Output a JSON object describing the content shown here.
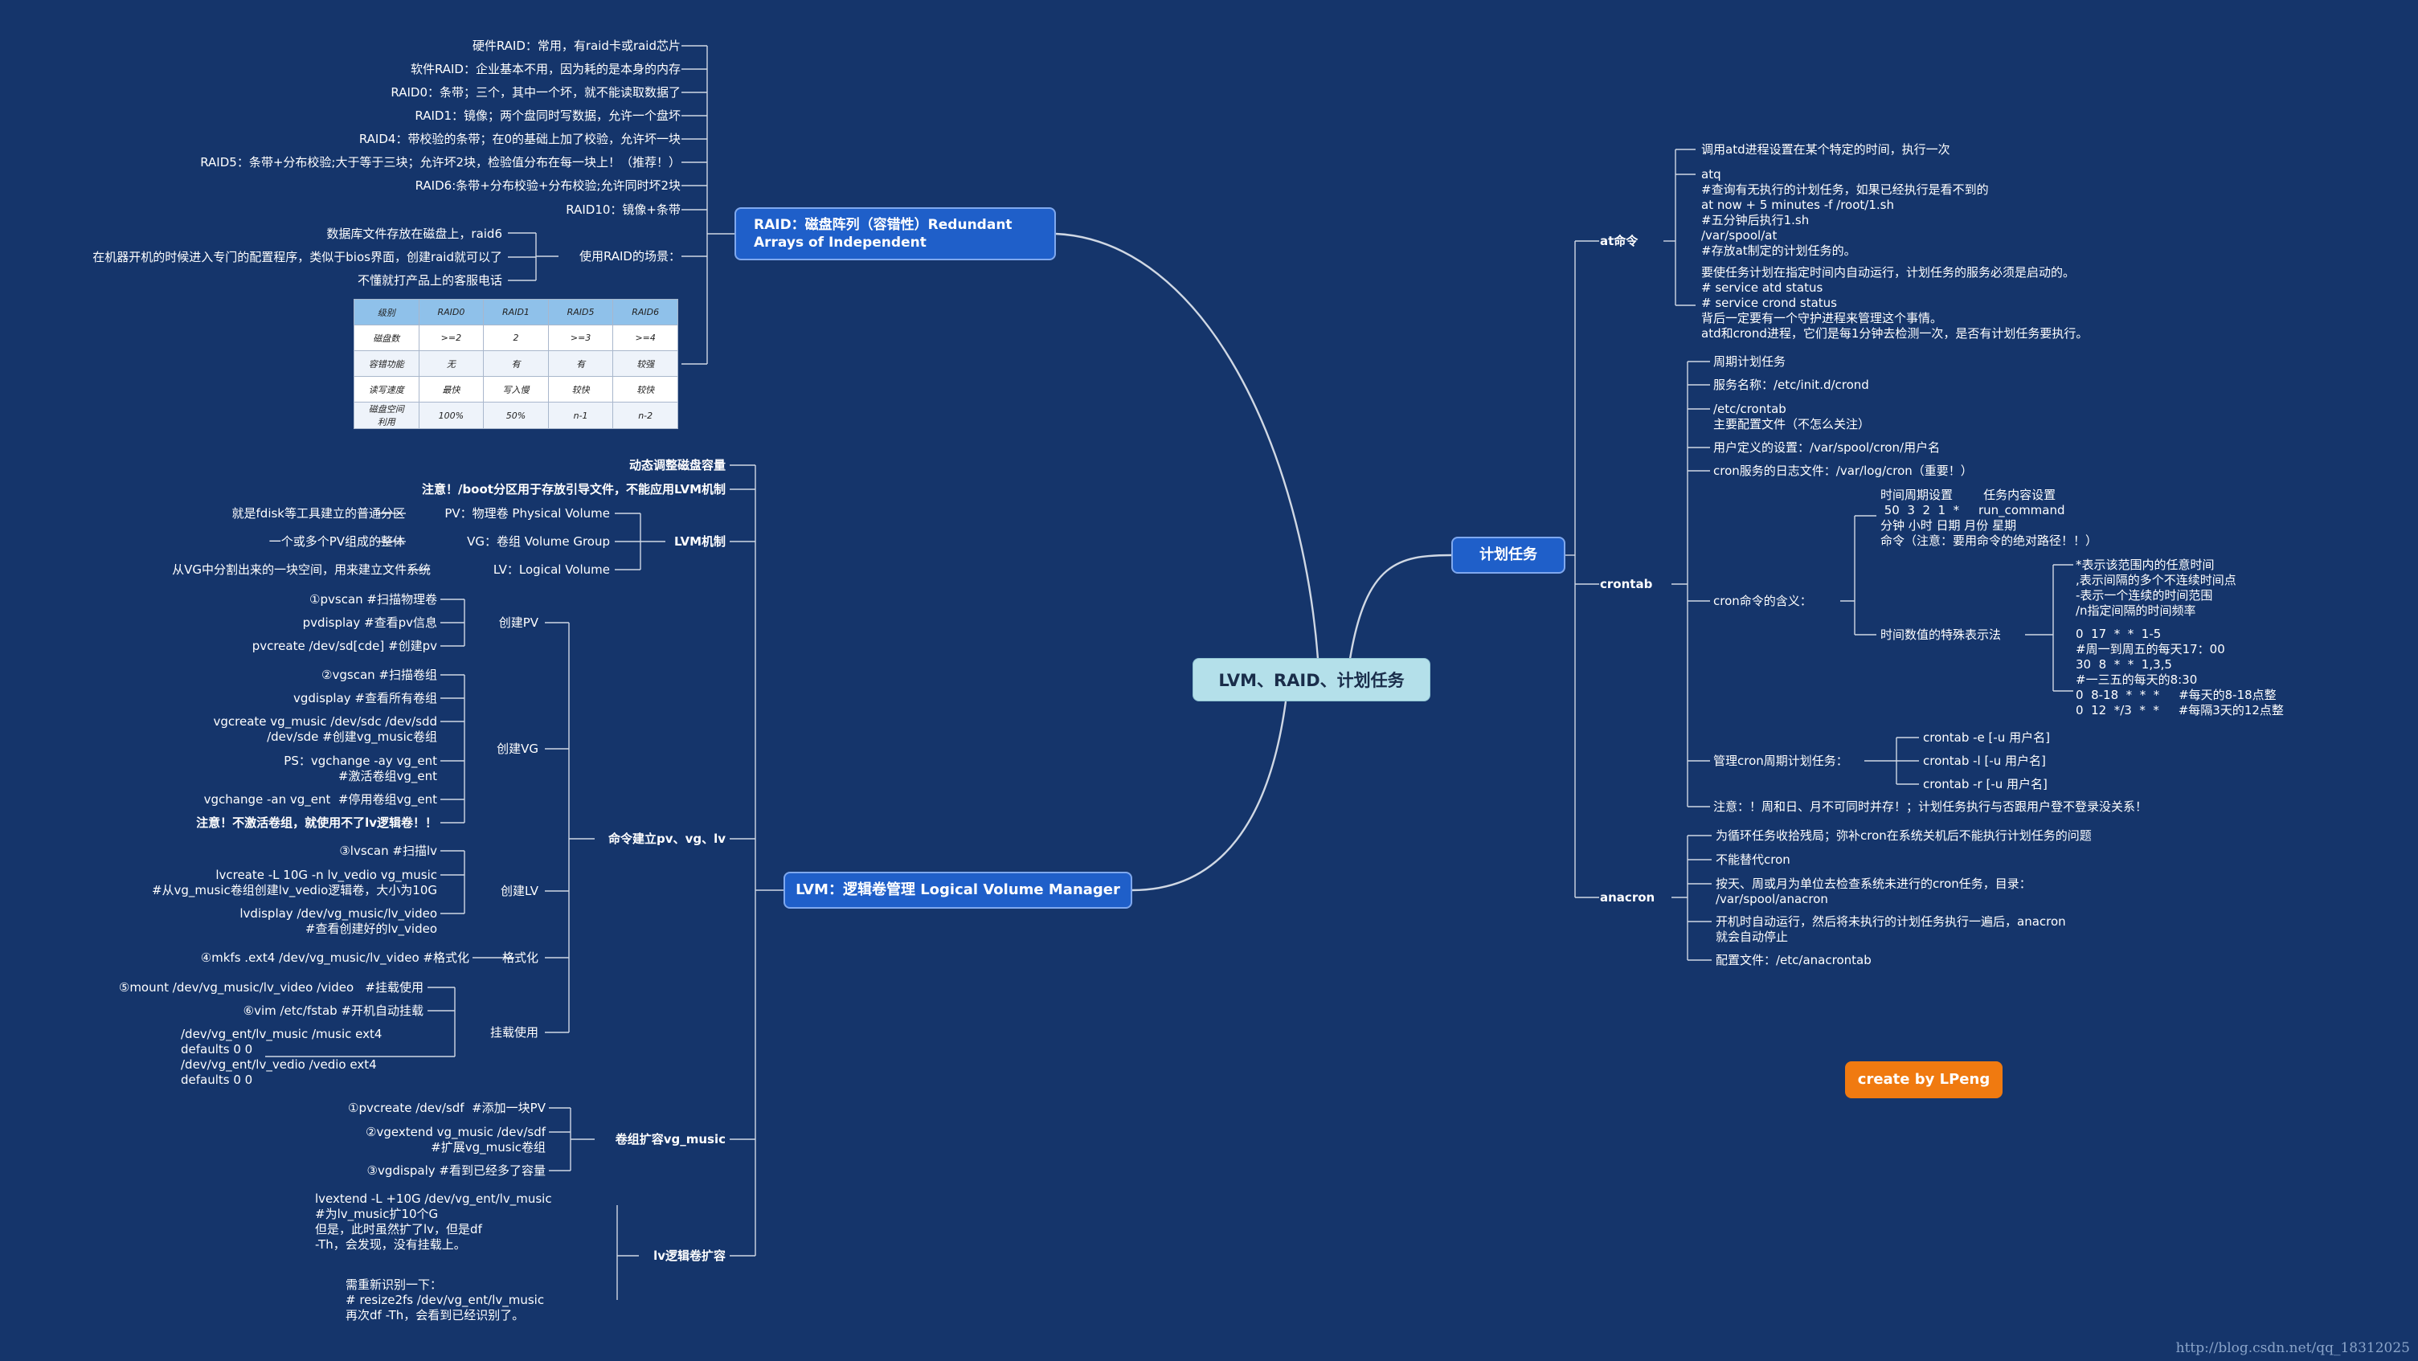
{
  "title": "LVM、RAID、计划任务",
  "credit": "create by LPeng",
  "watermark": "http://blog.csdn.net/qq_18312025",
  "colors": {
    "background": "#15356b",
    "center_topic": "#b4e0ea",
    "main_topic": "#1f5fc9",
    "credit": "#f07a10",
    "line": "#d0d8e4"
  },
  "raid": {
    "topic": "RAID：磁盘阵列（容错性）Redundant\nArrays of Independent",
    "items": [
      "硬件RAID：常用，有raid卡或raid芯片",
      "软件RAID：企业基本不用，因为耗的是本身的内存",
      "RAID0：条带；三个，其中一个坏，就不能读取数据了",
      "RAID1：镜像；两个盘同时写数据，允许一个盘坏",
      "RAID4：带校验的条带；在0的基础上加了校验，允许坏一块",
      "RAID5：条带+分布校验;大于等于三块；允许坏2块，检验值分布在每一块上！（推荐！）",
      "RAID6:条带+分布校验+分布校验;允许同时坏2块",
      "RAID10：镜像+条带"
    ],
    "scene_label": "使用RAID的场景：",
    "scenes": [
      "数据库文件存放在磁盘上，raid6",
      "在机器开机的时候进入专门的配置程序，类似于bios界面，创建raid就可以了",
      "不懂就打产品上的客服电话"
    ],
    "table": {
      "headers": [
        "级别",
        "RAID0",
        "RAID1",
        "RAID5",
        "RAID6"
      ],
      "rows": [
        [
          "磁盘数",
          ">=2",
          "2",
          ">=3",
          ">=4"
        ],
        [
          "容错功能",
          "无",
          "有",
          "有",
          "较强"
        ],
        [
          "读写速度",
          "最快",
          "写入慢",
          "较快",
          "较快"
        ],
        [
          "磁盘空间\n利用",
          "100%",
          "50%",
          "n-1",
          "n-2"
        ]
      ]
    }
  },
  "lvm": {
    "topic": "LVM：逻辑卷管理 Logical Volume Manager",
    "dynamic": "动态调整磁盘容量",
    "boot_note": "注意！/boot分区用于存放引导文件，不能应用LVM机制",
    "mechanism": {
      "label": "LVM机制",
      "items": [
        {
          "name": "PV：物理卷 Physical Volume",
          "desc": "就是fdisk等工具建立的普通分区"
        },
        {
          "name": "VG：卷组 Volume Group",
          "desc": "一个或多个PV组成的整体"
        },
        {
          "name": "LV：Logical Volume",
          "desc": "从VG中分割出来的一块空间，用来建立文件系统"
        }
      ]
    },
    "commands": {
      "label": "命令建立pv、vg、lv",
      "groups": [
        {
          "label": "创建PV",
          "items": [
            "①pvscan #扫描物理卷",
            "pvdisplay #查看pv信息",
            "pvcreate /dev/sd[cde] #创建pv"
          ]
        },
        {
          "label": "创建VG",
          "items": [
            "②vgscan #扫描卷组",
            "vgdisplay #查看所有卷组",
            "vgcreate vg_music /dev/sdc /dev/sdd\n/dev/sde #创建vg_music卷组",
            "PS：vgchange -ay vg_ent\n#激活卷组vg_ent",
            "vgchange -an vg_ent  #停用卷组vg_ent",
            "注意！不激活卷组，就使用不了lv逻辑卷！！"
          ]
        },
        {
          "label": "创建LV",
          "items": [
            "③lvscan #扫描lv",
            "lvcreate -L 10G -n lv_vedio vg_music\n#从vg_music卷组创建lv_vedio逻辑卷，大小为10G",
            "lvdisplay /dev/vg_music/lv_video\n#查看创建好的lv_video"
          ]
        },
        {
          "label": "格式化",
          "items": [
            "④mkfs .ext4 /dev/vg_music/lv_video #格式化"
          ]
        },
        {
          "label": "挂载使用",
          "items": [
            "⑤mount /dev/vg_music/lv_video /video   #挂载使用",
            "⑥vim /etc/fstab #开机自动挂载",
            "/dev/vg_ent/lv_music /music ext4\ndefaults 0 0\n/dev/vg_ent/lv_vedio /vedio ext4\ndefaults 0 0"
          ]
        }
      ]
    },
    "vg_extend": {
      "label": "卷组扩容vg_music",
      "items": [
        "①pvcreate /dev/sdf  #添加一块PV",
        "②vgextend vg_music /dev/sdf\n#扩展vg_music卷组",
        "③vgdispaly #看到已经多了容量"
      ]
    },
    "lv_extend": {
      "label": "lv逻辑卷扩容",
      "items": [
        "lvextend -L +10G /dev/vg_ent/lv_music\n#为lv_music扩10个G\n但是，此时虽然扩了lv，但是df\n-Th，会发现，没有挂载上。",
        "需重新识别一下：\n# resize2fs /dev/vg_ent/lv_music\n再次df -Th，会看到已经识别了。"
      ]
    }
  },
  "cron": {
    "topic": "计划任务",
    "at": {
      "label": "at命令",
      "items": [
        "调用atd进程设置在某个特定的时间，执行一次",
        "atq\n#查询有无执行的计划任务，如果已经执行是看不到的\nat now + 5 minutes -f /root/1.sh\n#五分钟后执行1.sh\n/var/spool/at\n#存放at制定的计划任务的。",
        "要使任务计划在指定时间内自动运行，计划任务的服务必须是启动的。\n# service atd status\n# service crond status\n背后一定要有一个守护进程来管理这个事情。\natd和crond进程，它们是每1分钟去检测一次，是否有计划任务要执行。"
      ]
    },
    "crontab": {
      "label": "crontab",
      "items": [
        "周期计划任务",
        "服务名称：/etc/init.d/crond",
        "/etc/crontab\n主要配置文件（不怎么关注）",
        "用户定义的设置：/var/spool/cron/用户名",
        "cron服务的日志文件：/var/log/cron（重要！）"
      ],
      "meaning_label": "cron命令的含义：",
      "meaning_items": [
        "时间周期设置        任务内容设置\n 50  3  2  1  *     run_command\n分钟 小时 日期 月份 星期\n命令（注意：要用命令的绝对路径！！）"
      ],
      "special_label": "时间数值的特殊表示法",
      "special_items": [
        "*表示该范围内的任意时间\n,表示间隔的多个不连续时间点\n-表示一个连续的时间范围\n/n指定间隔的时间频率",
        "0  17  *  *  1-5\n#周一到周五的每天17：00\n30  8  *  *  1,3,5\n#一三五的每天的8:30\n0  8-18  *  *  *     #每天的8-18点整\n0  12  */3  *  *     #每隔3天的12点整"
      ],
      "manage_label": "管理cron周期计划任务：",
      "manage_items": [
        "crontab -e [-u 用户名]",
        "crontab -l [-u 用户名]",
        "crontab -r [-u 用户名]"
      ],
      "note": "注意：！周和日、月不可同时并存！；计划任务执行与否跟用户登不登录没关系！"
    },
    "anacron": {
      "label": "anacron",
      "items": [
        "为循环任务收拾残局；弥补cron在系统关机后不能执行计划任务的问题",
        "不能替代cron",
        "按天、周或月为单位去检查系统未进行的cron任务，目录：\n/var/spool/anacron",
        "开机时自动运行，然后将未执行的计划任务执行一遍后，anacron\n就会自动停止",
        "配置文件：/etc/anacrontab"
      ]
    }
  }
}
